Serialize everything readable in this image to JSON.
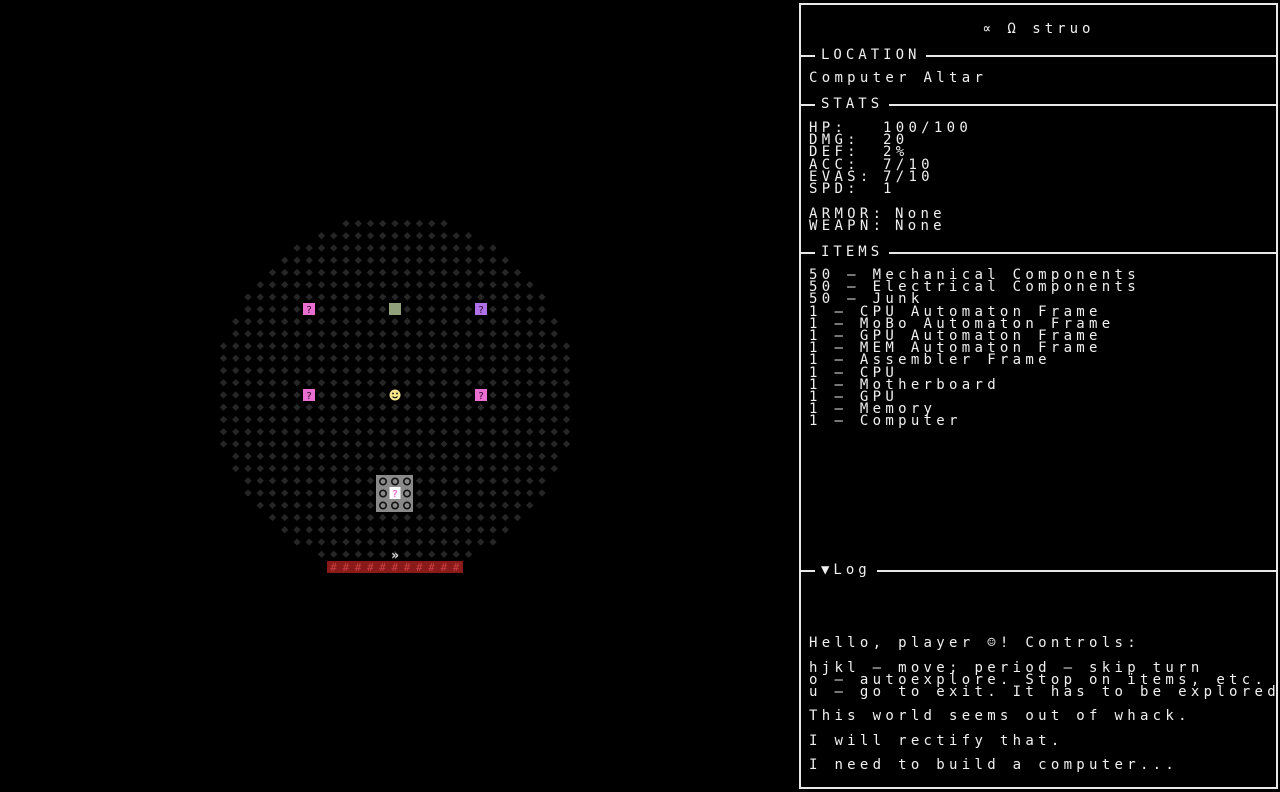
{
  "panel": {
    "title": "∝ Ω struo",
    "location": {
      "header": "LOCATION",
      "value": "Computer Altar"
    },
    "stats": {
      "header": "STATS",
      "rows": [
        {
          "key": "HP:",
          "value": "100/100"
        },
        {
          "key": "DMG:",
          "value": "20"
        },
        {
          "key": "DEF:",
          "value": "2%"
        },
        {
          "key": "ACC:",
          "value": "7/10"
        },
        {
          "key": "EVAS:",
          "value": "7/10"
        },
        {
          "key": "SPD:",
          "value": "1"
        }
      ],
      "equip": [
        {
          "key": "ARMOR:",
          "value": "None"
        },
        {
          "key": "WEAPN:",
          "value": "None"
        }
      ]
    },
    "items": {
      "header": "ITEMS",
      "list": [
        "50 — Mechanical Components",
        "50 — Electrical Components",
        "50 — Junk",
        "1 — CPU Automaton Frame",
        "1 — MoBo Automaton Frame",
        "1 — GPU Automaton Frame",
        "1 — MEM Automaton Frame",
        "1 — Assembler Frame",
        "1 — CPU",
        "1 — Motherboard",
        "1 — GPU",
        "1 — Memory",
        "1 — Computer"
      ]
    },
    "log": {
      "header": "▼Log",
      "lines": [
        "Hello, player ☺! Controls:",
        "hjkl — move; period — skip turn\no — autoexplore. Stop on items, etc.\nu — go to exit. It has to be explored.",
        "This world seems out of whack.",
        "I will rectify that.",
        "I need to build a computer..."
      ]
    }
  },
  "map": {
    "room_name": "Computer Altar",
    "player_glyph": "☺",
    "exit_glyph": "»",
    "item_glyph": "?",
    "wall_glyph": "#",
    "colors": {
      "floor": "#262626",
      "pink": "#e86fd0",
      "purple": "#b070e8",
      "green_tile": "#8fa07a",
      "player": "#f4e48a",
      "wall": "#8a1a1a",
      "wall_glyph": "#c84040",
      "altar": "#8a8a8a"
    },
    "objects": [
      {
        "type": "item",
        "color": "pink",
        "label": "?"
      },
      {
        "type": "item",
        "color": "green_tile",
        "label": ""
      },
      {
        "type": "item",
        "color": "purple",
        "label": "?"
      },
      {
        "type": "item",
        "color": "pink",
        "label": "?"
      },
      {
        "type": "player",
        "color": "player",
        "label": "☺"
      },
      {
        "type": "item",
        "color": "pink",
        "label": "?"
      },
      {
        "type": "altar_item",
        "color": "altar",
        "label": "?"
      },
      {
        "type": "exit",
        "color": "floor",
        "label": "»"
      }
    ]
  }
}
